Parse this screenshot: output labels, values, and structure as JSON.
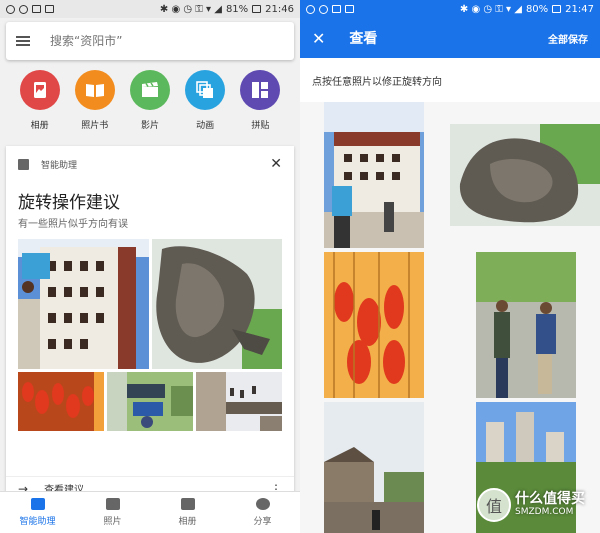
{
  "left": {
    "status": {
      "battery": "81%",
      "time": "21:46"
    },
    "search": {
      "placeholder": "搜索“资阳市”"
    },
    "actions": [
      {
        "label": "相册",
        "color": "#e04848",
        "icon": "album-icon"
      },
      {
        "label": "照片书",
        "color": "#f28c1e",
        "icon": "photobook-icon"
      },
      {
        "label": "影片",
        "color": "#5cb85c",
        "icon": "movie-icon"
      },
      {
        "label": "动画",
        "color": "#29a3e0",
        "icon": "animation-icon"
      },
      {
        "label": "拼贴",
        "color": "#5e4ab0",
        "icon": "collage-icon"
      }
    ],
    "card": {
      "header": "智能助理",
      "title": "旋转操作建议",
      "subtitle": "有一些照片似乎方向有误",
      "footer": "查看建议"
    },
    "nav": [
      {
        "label": "智能助理",
        "active": true
      },
      {
        "label": "照片",
        "active": false
      },
      {
        "label": "相册",
        "active": false
      },
      {
        "label": "分享",
        "active": false
      }
    ]
  },
  "right": {
    "status": {
      "battery": "80%",
      "time": "21:47"
    },
    "title": "查看",
    "save_all": "全部保存",
    "hint": "点按任意照片以修正旋转方向"
  },
  "watermark": {
    "line1": "什么值得买",
    "line2": "SMZDM.COM",
    "glyph": "值"
  }
}
